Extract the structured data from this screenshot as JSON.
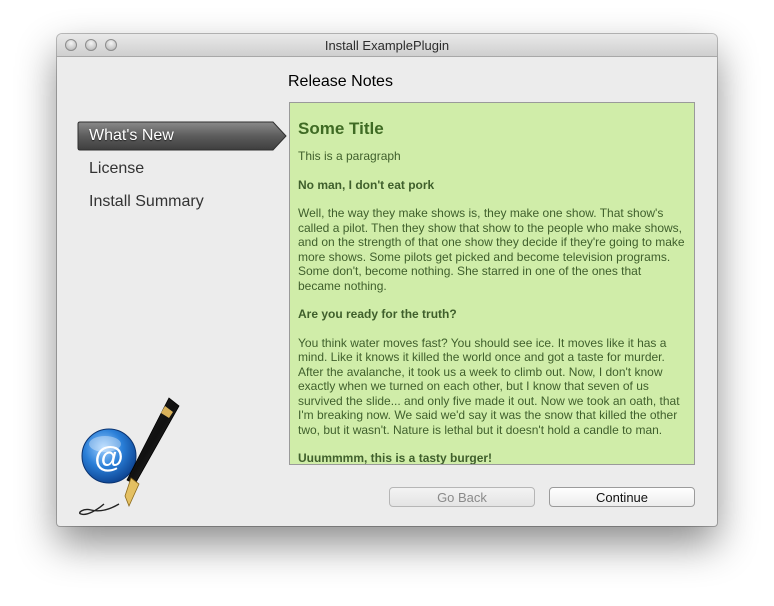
{
  "window": {
    "title": "Install ExamplePlugin"
  },
  "content": {
    "heading": "Release Notes"
  },
  "steps": [
    {
      "label": "What's New",
      "active": true
    },
    {
      "label": "License",
      "active": false
    },
    {
      "label": "Install Summary",
      "active": false
    }
  ],
  "notes": {
    "title": "Some Title",
    "p1": "This is a paragraph",
    "h2": "No man, I don't eat pork",
    "p2": "Well, the way they make shows is, they make one show. That show's called a pilot. Then they show that show to the people who make shows, and on the strength of that one show they decide if they're going to make more shows. Some pilots get picked and become television programs. Some don't, become nothing. She starred in one of the ones that became nothing.",
    "h3": "Are you ready for the truth?",
    "p3": "You think water moves fast? You should see ice. It moves like it has a mind. Like it knows it killed the world once and got a taste for murder. After the avalanche, it took us a week to climb out. Now, I don't know exactly when we turned on each other, but I know that seven of us survived the slide... and only five made it out. Now we took an oath, that I'm breaking now. We said we'd say it was the snow that killed the other two, but it wasn't. Nature is lethal but it doesn't hold a candle to man.",
    "h4": "Uuummmm, this is a tasty burger!",
    "background_color": "#d0eda9"
  },
  "buttons": {
    "back": "Go Back",
    "continue": "Continue"
  },
  "icons": {
    "logo": "email-at-with-fountain-pen-icon"
  }
}
